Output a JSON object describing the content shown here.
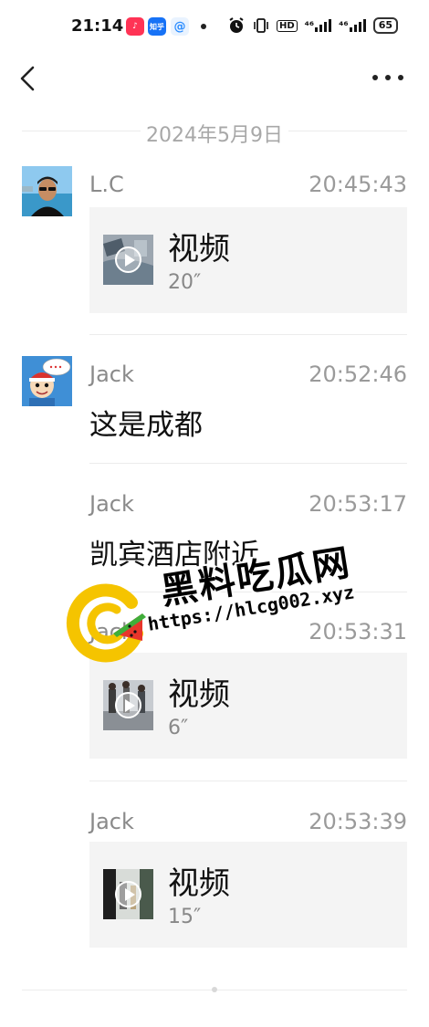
{
  "status_bar": {
    "time": "21:14",
    "apps": [
      {
        "name": "douyin-icon",
        "glyph": "♪",
        "color": "#ff3355"
      },
      {
        "name": "zhihu-icon",
        "glyph": "知乎",
        "color": "#1772f6"
      },
      {
        "name": "at-app-icon",
        "glyph": "@",
        "color": "#2a8cff"
      }
    ],
    "network_1": "⁴⁶",
    "network_2": "⁴⁶",
    "hd_label": "HD",
    "battery": "65"
  },
  "nav": {
    "back_icon": "chevron-left",
    "more_icon": "ellipsis"
  },
  "date_divider": "2024年5月9日",
  "messages": [
    {
      "sender": "L.C",
      "time": "20:45:43",
      "type": "video",
      "video_label": "视频",
      "duration": "20″"
    },
    {
      "sender": "Jack",
      "time": "20:52:46",
      "type": "text",
      "text": "这是成都"
    },
    {
      "sender": "Jack",
      "time": "20:53:17",
      "type": "text",
      "text": "凯宾酒店附近"
    },
    {
      "sender": "Jack",
      "time": "20:53:31",
      "type": "video",
      "video_label": "视频",
      "duration": "6″"
    },
    {
      "sender": "Jack",
      "time": "20:53:39",
      "type": "video",
      "video_label": "视频",
      "duration": "15″"
    }
  ],
  "watermark": {
    "title": "黑料吃瓜网",
    "url": "https://hlcg002.xyz"
  },
  "colors": {
    "card_bg": "#f4f4f4",
    "muted_text": "#9a9a9a",
    "watermark_yellow": "#f5c400",
    "watermark_red": "#e8352b"
  }
}
